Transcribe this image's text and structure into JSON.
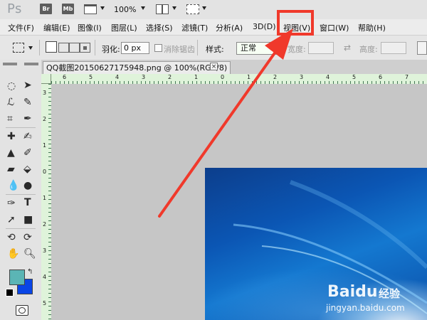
{
  "app": {
    "logo": "Ps",
    "bridge_btn": "Br",
    "minibridge_btn": "Mb",
    "zoom": "100%"
  },
  "menu": [
    {
      "label": "文件(F)"
    },
    {
      "label": "编辑(E)"
    },
    {
      "label": "图像(I)"
    },
    {
      "label": "图层(L)"
    },
    {
      "label": "选择(S)"
    },
    {
      "label": "滤镜(T)"
    },
    {
      "label": "分析(A)"
    },
    {
      "label": "3D(D)"
    },
    {
      "label": "视图(V)"
    },
    {
      "label": "窗口(W)"
    },
    {
      "label": "帮助(H)"
    }
  ],
  "options": {
    "feather_label": "羽化:",
    "feather_value": "0 px",
    "antialias_label": "消除锯齿",
    "style_label": "样式:",
    "style_value": "正常",
    "width_label": "宽度:",
    "height_label": "高度:"
  },
  "document": {
    "tab_title": "QQ截图20150627175948.png @ 100%(RGB/8)",
    "close_glyph": "×"
  },
  "rulers": {
    "h": [
      "6",
      "5",
      "4",
      "3",
      "2",
      "1",
      "0",
      "1",
      "2",
      "3",
      "4",
      "5",
      "6",
      "7",
      "8"
    ],
    "v": [
      "3",
      "2",
      "1",
      "0",
      "1",
      "2",
      "3",
      "4",
      "5"
    ]
  },
  "colors": {
    "foreground": "#5bb5b5",
    "background": "#0a46e6",
    "annotation": "#f0392b",
    "ruler": "#dff3da"
  },
  "watermark": {
    "logo": "Baidu",
    "sub": "经验",
    "url": "jingyan.baidu.com"
  }
}
